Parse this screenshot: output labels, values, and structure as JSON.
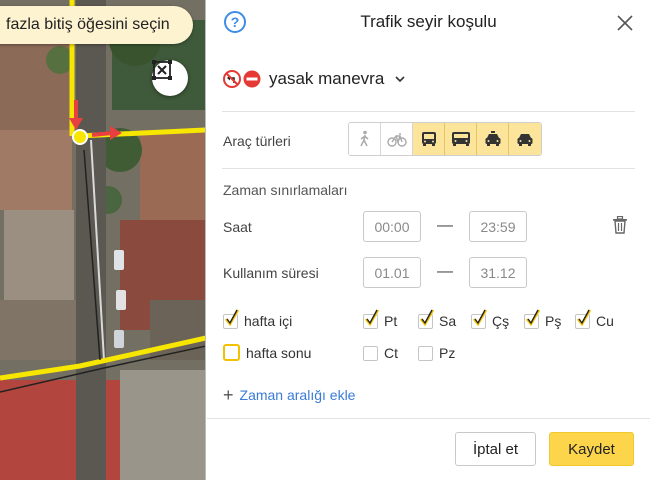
{
  "map": {
    "hint_text": "fazla bitiş öğesini seçin"
  },
  "panel": {
    "title": "Trafik seyir koşulu",
    "help_symbol": "?",
    "condition": {
      "label": "yasak manevra",
      "icons": [
        "no-left-turn-icon",
        "no-entry-icon"
      ]
    },
    "vehicle_types": {
      "label": "Araç türleri",
      "items": [
        {
          "name": "pedestrian",
          "icon": "pedestrian-icon",
          "active": false
        },
        {
          "name": "bicycle",
          "icon": "bicycle-icon",
          "active": false
        },
        {
          "name": "bus",
          "icon": "bus-icon",
          "active": true
        },
        {
          "name": "truck",
          "icon": "truck-icon",
          "active": true
        },
        {
          "name": "taxi",
          "icon": "taxi-icon",
          "active": true
        },
        {
          "name": "car",
          "icon": "car-icon",
          "active": true
        }
      ]
    },
    "time_limits": {
      "title": "Zaman sınırlamaları",
      "time": {
        "label": "Saat",
        "from": "00:00",
        "to": "23:59"
      },
      "period": {
        "label": "Kullanım süresi",
        "from": "01.01",
        "to": "31.12"
      },
      "dash": "—",
      "weekdays_all": {
        "label": "hafta içi",
        "checked": true
      },
      "weekend_all": {
        "label": "hafta sonu",
        "checked": false
      },
      "days": [
        {
          "label": "Pt",
          "checked": true
        },
        {
          "label": "Sa",
          "checked": true
        },
        {
          "label": "Çş",
          "checked": true
        },
        {
          "label": "Pş",
          "checked": true
        },
        {
          "label": "Cu",
          "checked": true
        },
        {
          "label": "Ct",
          "checked": false
        },
        {
          "label": "Pz",
          "checked": false
        }
      ]
    },
    "add_range": {
      "plus": "+",
      "label": "Zaman aralığı ekle"
    },
    "buttons": {
      "cancel": "İptal et",
      "save": "Kaydet"
    }
  },
  "colors": {
    "accent_yellow": "#fcd54a",
    "link_blue": "#3a7bd5",
    "route_yellow": "#f7e600",
    "arrow_red": "#e84040"
  }
}
